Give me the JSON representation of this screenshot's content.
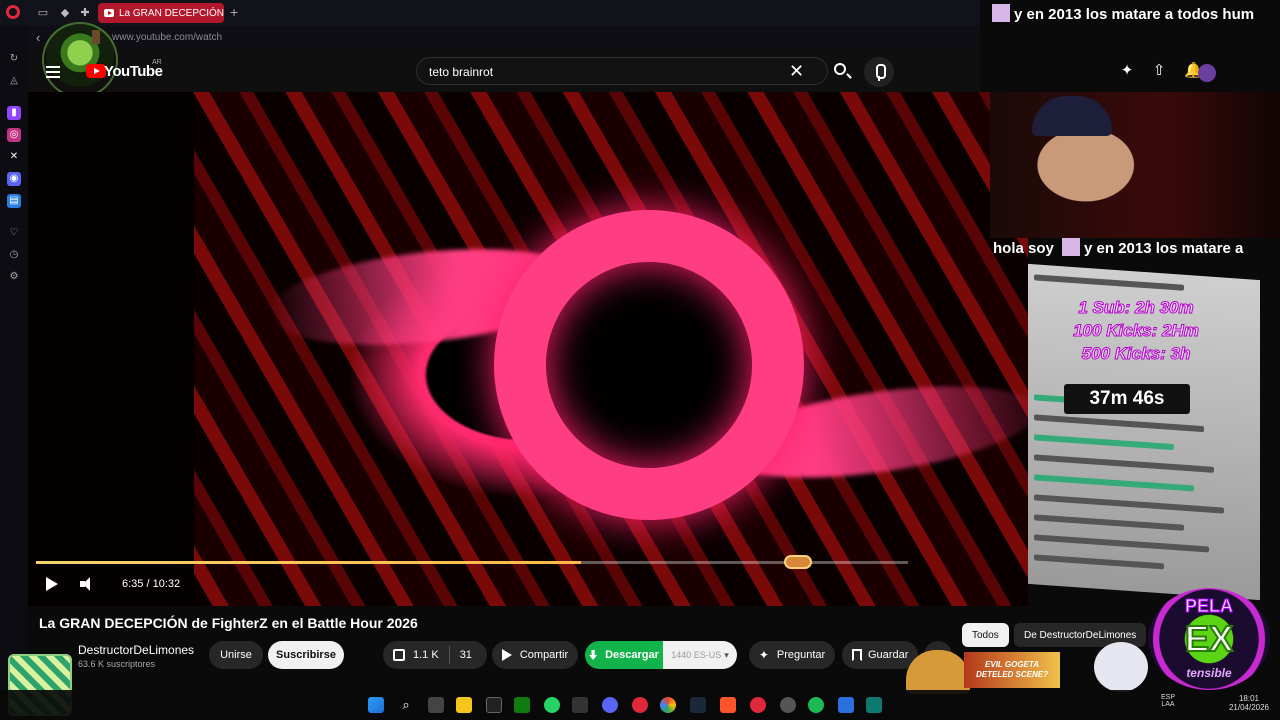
{
  "browser": {
    "active_tab_title": "La GRAN DECEPCIÓN",
    "new_tab_label": "+",
    "url": "www.youtube.com/watch"
  },
  "youtube": {
    "logo_text": "YouTube",
    "country_code": "AR",
    "search_query": "teto brainrot",
    "clear_glyph": "✕"
  },
  "player": {
    "current_time": "6:35",
    "duration": "10:32",
    "time_display": "6:35 / 10:32",
    "progress_percent": 62.5
  },
  "video": {
    "title": "La GRAN DECEPCIÓN de FighterZ en el Battle Hour 2026",
    "channel_name": "DestructorDeLimones",
    "subscribers": "63.6 K suscriptores",
    "join_label": "Unirse",
    "subscribe_label": "Suscribirse",
    "like_count": "1.1 K",
    "comment_count": "31",
    "share_label": "Compartir",
    "download_label": "Descargar",
    "download_quality": "1440 ES-US",
    "ask_label": "Preguntar",
    "save_label": "Guardar",
    "more_label": "•••"
  },
  "recommendation_chips": {
    "all": "Todos",
    "from_channel": "De DestructorDeLimones"
  },
  "stream_overlay": {
    "banner_top": "y en 2013 los matare a todos hum",
    "banner_mid_a": "hola soy",
    "banner_mid_b": "y en 2013 los matare a",
    "goal_1": "1 Sub: 2h 30m",
    "goal_2": "100 Kicks: 2Hm",
    "goal_3": "500 Kicks: 3h",
    "countdown": "37m 46s",
    "badge_top": "PELA",
    "badge_mid": "EX",
    "badge_bottom": "tensible",
    "thumb_line1": "EVIL GOGETA",
    "thumb_line2": "DETELED SCENE?"
  },
  "taskbar": {
    "lang_1": "ESP",
    "lang_2": "LAA",
    "clock_time": "18:01",
    "clock_date": "21/04/2026"
  },
  "colors": {
    "accent_red": "#ff0000",
    "download_green": "#12b34b",
    "video_pink": "#ff3d82",
    "progress_gold": "#f5d36b"
  }
}
